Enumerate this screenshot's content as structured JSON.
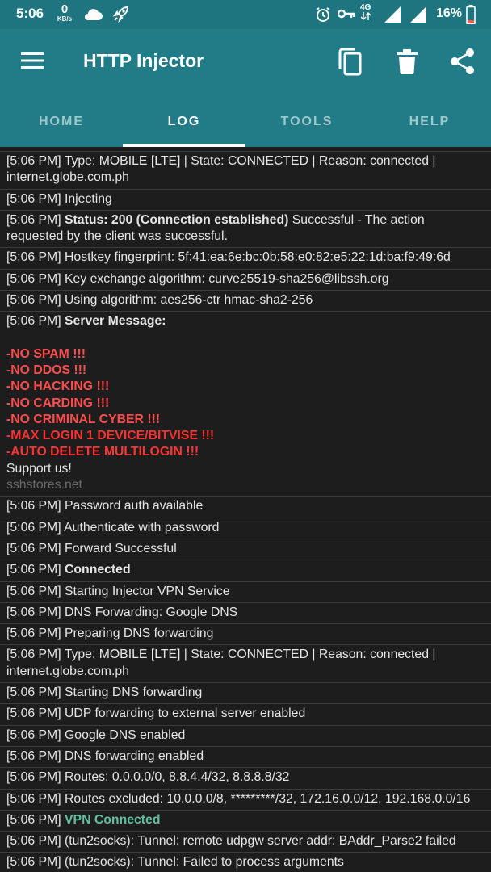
{
  "status_bar": {
    "time": "5:06",
    "net_speed": "0",
    "net_unit": "KB/s",
    "network_type": "4G",
    "battery": "16%"
  },
  "app_bar": {
    "title": "HTTP Injector"
  },
  "tabs": [
    {
      "label": "HOME",
      "active": false
    },
    {
      "label": "LOG",
      "active": true
    },
    {
      "label": "TOOLS",
      "active": false
    },
    {
      "label": "HELP",
      "active": false
    }
  ],
  "log": {
    "e1": {
      "ts": "[5:06 PM]",
      "text": " Type: MOBILE [LTE] | State: CONNECTED | Reason: connected | internet.globe.com.ph"
    },
    "e2": {
      "ts": "[5:06 PM]",
      "text": " Injecting"
    },
    "e3": {
      "ts": "[5:06 PM]",
      "bold": "Status: 200 (Connection established)",
      "text": " Successful - The action requested by the client was successful."
    },
    "e4": {
      "ts": "[5:06 PM]",
      "text": " Hostkey fingerprint: 5f:41:ea:6e:bc:0b:58:e0:82:e5:22:1d:ba:f9:49:6d"
    },
    "e5": {
      "ts": "[5:06 PM]",
      "text": " Key exchange algorithm: curve25519-sha256@libssh.org"
    },
    "e6": {
      "ts": "[5:06 PM]",
      "text": " Using algorithm: aes256-ctr hmac-sha2-256"
    },
    "e7": {
      "ts": "[5:06 PM]",
      "bold": "Server Message:",
      "rules": [
        "-NO SPAM !!!",
        "-NO DDOS !!!",
        "-NO HACKING !!!",
        "-NO CARDING !!!",
        "-NO CRIMINAL CYBER !!!",
        "-MAX LOGIN 1 DEVICE/BITVISE !!!",
        "-AUTO DELETE MULTILOGIN !!!"
      ],
      "support": "Support us!",
      "site": "sshstores.net"
    },
    "e8": {
      "ts": "[5:06 PM]",
      "text": " Password auth available"
    },
    "e9": {
      "ts": "[5:06 PM]",
      "text": " Authenticate with password"
    },
    "e10": {
      "ts": "[5:06 PM]",
      "text": " Forward Successful"
    },
    "e11": {
      "ts": "[5:06 PM]",
      "bold": " Connected"
    },
    "e12": {
      "ts": "[5:06 PM]",
      "text": " Starting Injector VPN Service"
    },
    "e13": {
      "ts": "[5:06 PM]",
      "text": " DNS Forwarding: Google DNS"
    },
    "e14": {
      "ts": "[5:06 PM]",
      "text": " Preparing DNS forwarding"
    },
    "e15": {
      "ts": "[5:06 PM]",
      "text": " Type: MOBILE [LTE] | State: CONNECTED | Reason: connected | internet.globe.com.ph"
    },
    "e16": {
      "ts": "[5:06 PM]",
      "text": " Starting DNS forwarding"
    },
    "e17": {
      "ts": "[5:06 PM]",
      "text": " UDP forwarding to external server enabled"
    },
    "e18": {
      "ts": "[5:06 PM]",
      "text": " Google DNS enabled"
    },
    "e19": {
      "ts": "[5:06 PM]",
      "text": " DNS forwarding enabled"
    },
    "e20": {
      "ts": "[5:06 PM]",
      "text": " Routes: 0.0.0.0/0, 8.8.4.4/32, 8.8.8.8/32"
    },
    "e21": {
      "ts": "[5:06 PM]",
      "text": " Routes excluded: 10.0.0.0/8, *********/32, 172.16.0.0/12, 192.168.0.0/16"
    },
    "e22": {
      "ts": "[5:06 PM]",
      "green": " VPN Connected"
    },
    "e23": {
      "ts": "[5:06 PM]",
      "text": " (tun2socks): Tunnel: remote udpgw server addr: BAddr_Parse2 failed"
    },
    "e24": {
      "ts": "[5:06 PM]",
      "text": " (tun2socks): Tunnel: Failed to process arguments"
    }
  },
  "colors": {
    "status_bar": "#1e7580",
    "app_bar": "#217c87",
    "background": "#1d1d1d",
    "rule_red": "#ff4d4d",
    "vpn_green": "#5fc09e"
  }
}
